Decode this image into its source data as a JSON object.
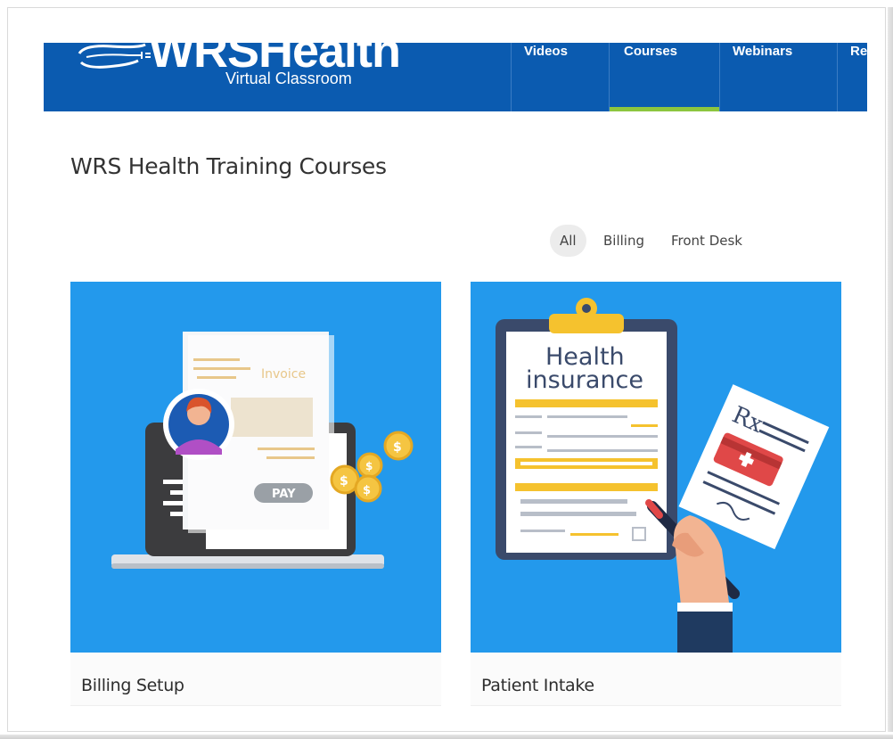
{
  "header": {
    "logo_title": "WRSHealth",
    "logo_subtitle": "Virtual Classroom",
    "nav": [
      {
        "label": "Videos"
      },
      {
        "label": "Courses"
      },
      {
        "label": "Webinars"
      },
      {
        "label": "Re"
      }
    ],
    "active_nav": "Courses",
    "colors": {
      "header_bg": "#0b5bb0",
      "active_indicator": "#8cc63f"
    }
  },
  "page": {
    "title": "WRS Health Training Courses"
  },
  "filters": {
    "items": [
      {
        "label": "All"
      },
      {
        "label": "Billing"
      },
      {
        "label": "Front Desk"
      }
    ],
    "selected": "All"
  },
  "courses": [
    {
      "title": "Billing Setup",
      "image_icon": "invoice-laptop-illustration",
      "image_text": {
        "invoice": "Invoice",
        "pay": "PAY",
        "coin": "$"
      }
    },
    {
      "title": "Patient Intake",
      "image_icon": "health-insurance-clipboard-illustration",
      "image_text": {
        "line1": "Health",
        "line2": "insurance",
        "rx": "Rx"
      }
    }
  ],
  "colors": {
    "card_image_bg": "#2399ec"
  }
}
